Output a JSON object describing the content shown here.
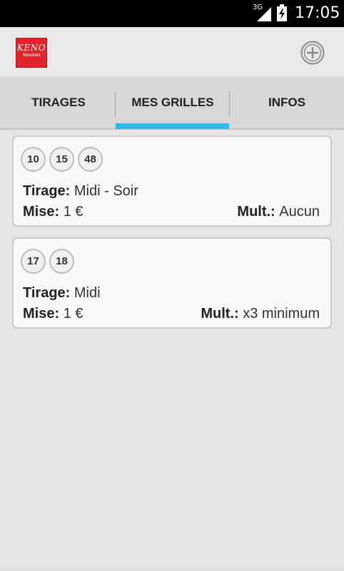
{
  "status_bar": {
    "network": "3G",
    "time": "17:05"
  },
  "app_bar": {
    "logo_line1": "KENO",
    "logo_line2": "Résultats"
  },
  "tabs": [
    {
      "label": "TIRAGES",
      "selected": false
    },
    {
      "label": "MES GRILLES",
      "selected": true
    },
    {
      "label": "INFOS",
      "selected": false
    }
  ],
  "colors": {
    "accent": "#33b5e5",
    "logo": "#e3232b"
  },
  "grids": [
    {
      "numbers": [
        "10",
        "15",
        "48"
      ],
      "tirage_label": "Tirage:",
      "tirage_value": "Midi - Soir",
      "mise_label": "Mise:",
      "mise_value": "1 €",
      "mult_label": "Mult.:",
      "mult_value": "Aucun"
    },
    {
      "numbers": [
        "17",
        "18"
      ],
      "tirage_label": "Tirage:",
      "tirage_value": "Midi",
      "mise_label": "Mise:",
      "mise_value": "1 €",
      "mult_label": "Mult.:",
      "mult_value": "x3 minimum"
    }
  ]
}
